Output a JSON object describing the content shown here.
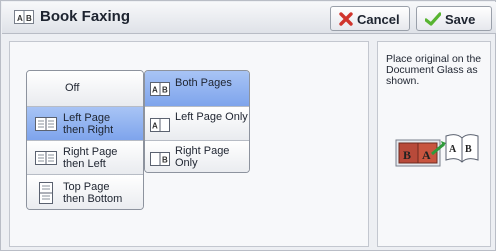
{
  "header": {
    "title": "Book Faxing",
    "cancel_label": "Cancel",
    "save_label": "Save"
  },
  "options_left": [
    {
      "label_line1": "Off",
      "label_line2": "",
      "selected": false
    },
    {
      "label_line1": "Left Page",
      "label_line2": "then Right",
      "selected": true
    },
    {
      "label_line1": "Right Page",
      "label_line2": "then Left",
      "selected": false
    },
    {
      "label_line1": "Top Page",
      "label_line2": "then Bottom",
      "selected": false
    }
  ],
  "options_right": [
    {
      "label": "Both Pages",
      "selected": true
    },
    {
      "label": "Left Page Only",
      "selected": false
    },
    {
      "label": "Right Page Only",
      "selected": false
    }
  ],
  "info": {
    "text": "Place original on the Document Glass as shown."
  },
  "colors": {
    "selected": "#8fb1f0",
    "cancel_x": "#d0342c",
    "save_check": "#58b431"
  }
}
